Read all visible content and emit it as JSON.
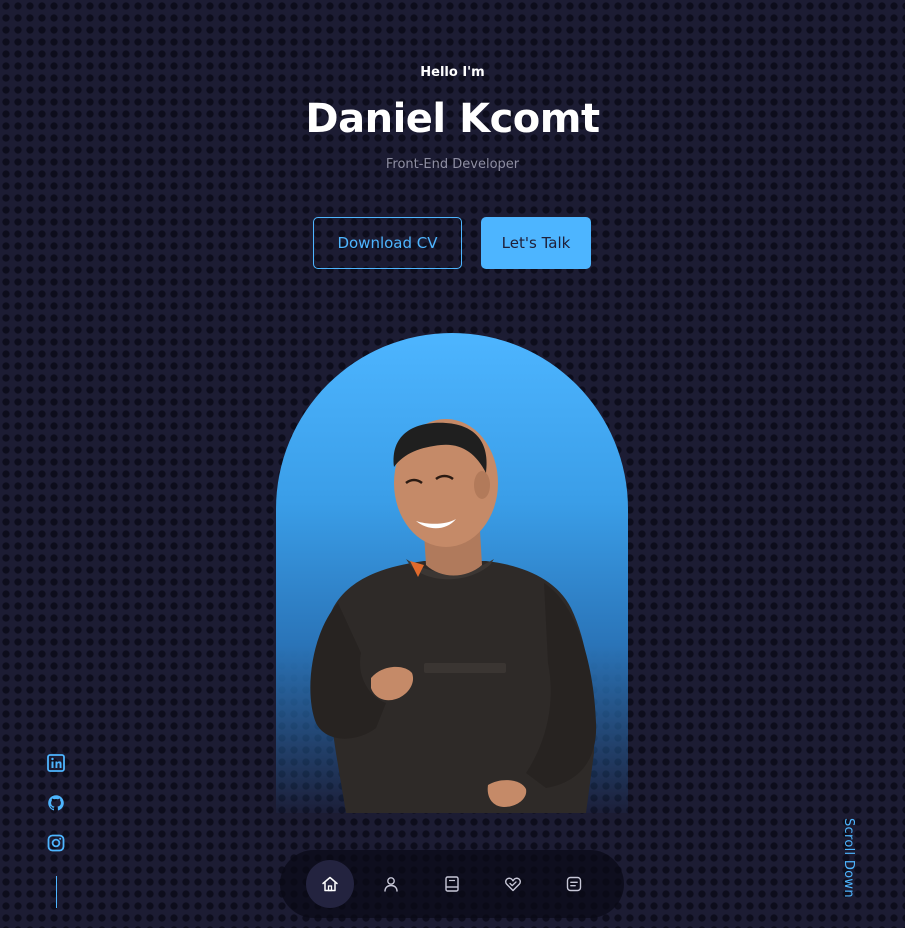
{
  "hero": {
    "greeting": "Hello I'm",
    "name": "Daniel Kcomt",
    "role": "Front-End Developer"
  },
  "buttons": {
    "download_cv": "Download CV",
    "lets_talk": "Let's Talk"
  },
  "portrait": {
    "alt": "Photo of Daniel Kcomt smiling in a dark sweatshirt"
  },
  "socials": [
    {
      "icon": "linkedin-icon"
    },
    {
      "icon": "github-icon"
    },
    {
      "icon": "instagram-icon"
    }
  ],
  "scroll_down": "Scroll Down",
  "nav": {
    "items": [
      {
        "icon": "home-icon",
        "active": true
      },
      {
        "icon": "user-icon",
        "active": false
      },
      {
        "icon": "book-icon",
        "active": false
      },
      {
        "icon": "services-icon",
        "active": false
      },
      {
        "icon": "message-icon",
        "active": false
      }
    ]
  },
  "colors": {
    "accent": "#4db5ff",
    "background": "#1c1c33",
    "text_muted": "#8f8fa3",
    "nav_background": "#0a0a16",
    "nav_active": "#23233f"
  }
}
